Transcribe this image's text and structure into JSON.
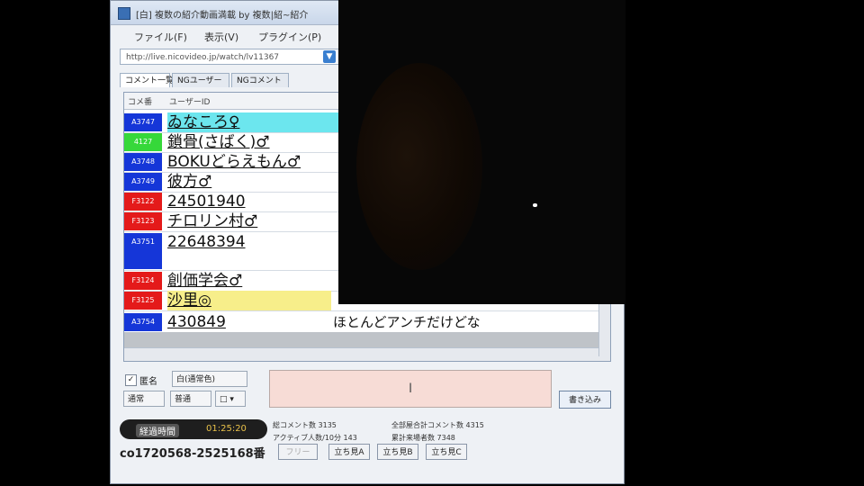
{
  "window": {
    "title": "[白] 複数の紹介動画満載 by 複数|紹~紹介",
    "menu": [
      "ファイル(F)",
      "表示(V)",
      "プラグイン(P)"
    ],
    "url": "http://live.nicovideo.jp/watch/lv11367"
  },
  "tabs": [
    "コメント一覧",
    "NGユーザー",
    "NGコメント"
  ],
  "grid": {
    "headers": [
      "コメ番",
      "ユーザーID"
    ],
    "rows": [
      {
        "badge": "A3747",
        "badge_color": "#1536d8",
        "user": "ゐなころ♀",
        "comment": "",
        "highlight": "#6ce6ee"
      },
      {
        "badge": "4127",
        "badge_color": "#36d83a",
        "user": "鎖骨(さばく)♂",
        "comment": "",
        "highlight": ""
      },
      {
        "badge": "A3748",
        "badge_color": "#1536d8",
        "user": "BOKUどらえもん♂",
        "comment": "",
        "highlight": ""
      },
      {
        "badge": "A3749",
        "badge_color": "#1536d8",
        "user": "彼方♂",
        "comment": "",
        "highlight": ""
      },
      {
        "badge": "F3122",
        "badge_color": "#e41a1a",
        "user": "24501940",
        "comment": "",
        "highlight": ""
      },
      {
        "badge": "F3123",
        "badge_color": "#e41a1a",
        "user": "チロリン村♂",
        "comment": "",
        "highlight": ""
      },
      {
        "badge": "A3751",
        "badge_color": "#1536d8",
        "user": "22648394",
        "comment": "",
        "highlight": ""
      },
      {
        "badge": "F3124",
        "badge_color": "#e41a1a",
        "user": "創価学会♂",
        "comment": "",
        "highlight": ""
      },
      {
        "badge": "F3125",
        "badge_color": "#e41a1a",
        "user": "沙里◎",
        "comment": "",
        "highlight": "#f7ee8a"
      },
      {
        "badge": "A3754",
        "badge_color": "#1536d8",
        "user": "430849",
        "comment": "ほとんどアンチだけどな",
        "highlight": ""
      }
    ]
  },
  "controls": {
    "checkbox_label": "匿名",
    "color_select": "白(通常色)",
    "size_select": "通常",
    "position_select": "普通",
    "submit_label": "書き込み"
  },
  "status": {
    "elapsed_label": "経過時間",
    "elapsed_time": "01:25:20",
    "comments_total": "総コメント数 3135",
    "active_users": "アクティブ人数/10分 143",
    "all_comments": "全部屋合計コメント数 4315",
    "visitors": "累計来場者数 7348",
    "community": "co1720568-2525168番"
  },
  "buttons": [
    "フリー",
    "立ち見A",
    "立ち見B",
    "立ち見C"
  ]
}
